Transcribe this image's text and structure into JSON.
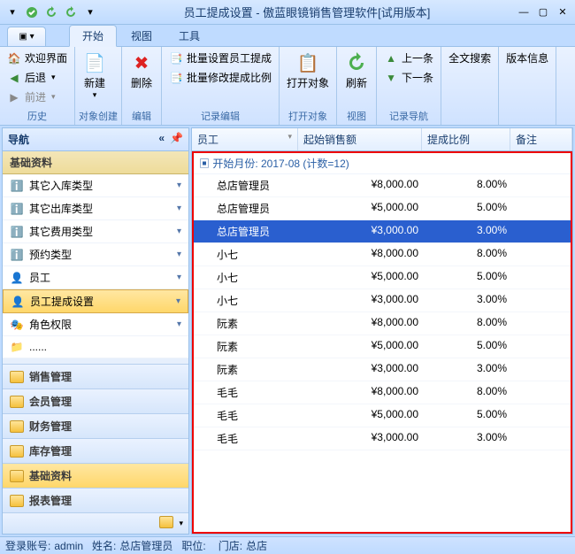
{
  "title": "员工提成设置 - 傲蓝眼镜销售管理软件[试用版本]",
  "tabs": {
    "start": "开始",
    "view": "视图",
    "tools": "工具"
  },
  "ribbon": {
    "history": {
      "welcome": "欢迎界面",
      "back": "后退",
      "forward": "前进",
      "label": "历史"
    },
    "createObj": {
      "newItem": "新建",
      "label": "对象创建"
    },
    "edit": {
      "deleteItem": "删除",
      "label": "编辑"
    },
    "recordEdit": {
      "batchSet": "批量设置员工提成",
      "batchModify": "批量修改提成比例",
      "label": "记录编辑"
    },
    "openObj": {
      "open": "打开对象",
      "label": "打开对象"
    },
    "viewG": {
      "refresh": "刷新",
      "label": "视图"
    },
    "recordNav": {
      "prev": "上一条",
      "next": "下一条",
      "label": "记录导航"
    },
    "search": {
      "fulltext": "全文搜索"
    },
    "version": {
      "info": "版本信息"
    }
  },
  "nav": {
    "title": "导航",
    "section": "基础资料",
    "items": [
      {
        "label": "其它入库类型",
        "icon": "info"
      },
      {
        "label": "其它出库类型",
        "icon": "info"
      },
      {
        "label": "其它费用类型",
        "icon": "info"
      },
      {
        "label": "预约类型",
        "icon": "info"
      },
      {
        "label": "员工",
        "icon": "user"
      },
      {
        "label": "员工提成设置",
        "icon": "user",
        "active": true
      },
      {
        "label": "角色权限",
        "icon": "mask"
      }
    ],
    "groups": [
      "销售管理",
      "会员管理",
      "财务管理",
      "库存管理",
      "基础资料",
      "报表管理"
    ]
  },
  "grid": {
    "columns": [
      "员工",
      "起始销售额",
      "提成比例",
      "备注"
    ],
    "groupLabel": "开始月份: 2017-08 (计数=12)",
    "rows": [
      {
        "emp": "总店管理员",
        "amt": "¥8,000.00",
        "rate": "8.00%",
        "sel": false
      },
      {
        "emp": "总店管理员",
        "amt": "¥5,000.00",
        "rate": "5.00%",
        "sel": false
      },
      {
        "emp": "总店管理员",
        "amt": "¥3,000.00",
        "rate": "3.00%",
        "sel": true
      },
      {
        "emp": "小七",
        "amt": "¥8,000.00",
        "rate": "8.00%",
        "sel": false
      },
      {
        "emp": "小七",
        "amt": "¥5,000.00",
        "rate": "5.00%",
        "sel": false
      },
      {
        "emp": "小七",
        "amt": "¥3,000.00",
        "rate": "3.00%",
        "sel": false
      },
      {
        "emp": "阮素",
        "amt": "¥8,000.00",
        "rate": "8.00%",
        "sel": false
      },
      {
        "emp": "阮素",
        "amt": "¥5,000.00",
        "rate": "5.00%",
        "sel": false
      },
      {
        "emp": "阮素",
        "amt": "¥3,000.00",
        "rate": "3.00%",
        "sel": false
      },
      {
        "emp": "毛毛",
        "amt": "¥8,000.00",
        "rate": "8.00%",
        "sel": false
      },
      {
        "emp": "毛毛",
        "amt": "¥5,000.00",
        "rate": "5.00%",
        "sel": false
      },
      {
        "emp": "毛毛",
        "amt": "¥3,000.00",
        "rate": "3.00%",
        "sel": false
      }
    ]
  },
  "status": {
    "accountL": "登录账号:",
    "account": "admin",
    "nameL": "姓名:",
    "name": "总店管理员",
    "positionL": "职位:",
    "position": "",
    "storeL": "门店:",
    "store": "总店"
  }
}
